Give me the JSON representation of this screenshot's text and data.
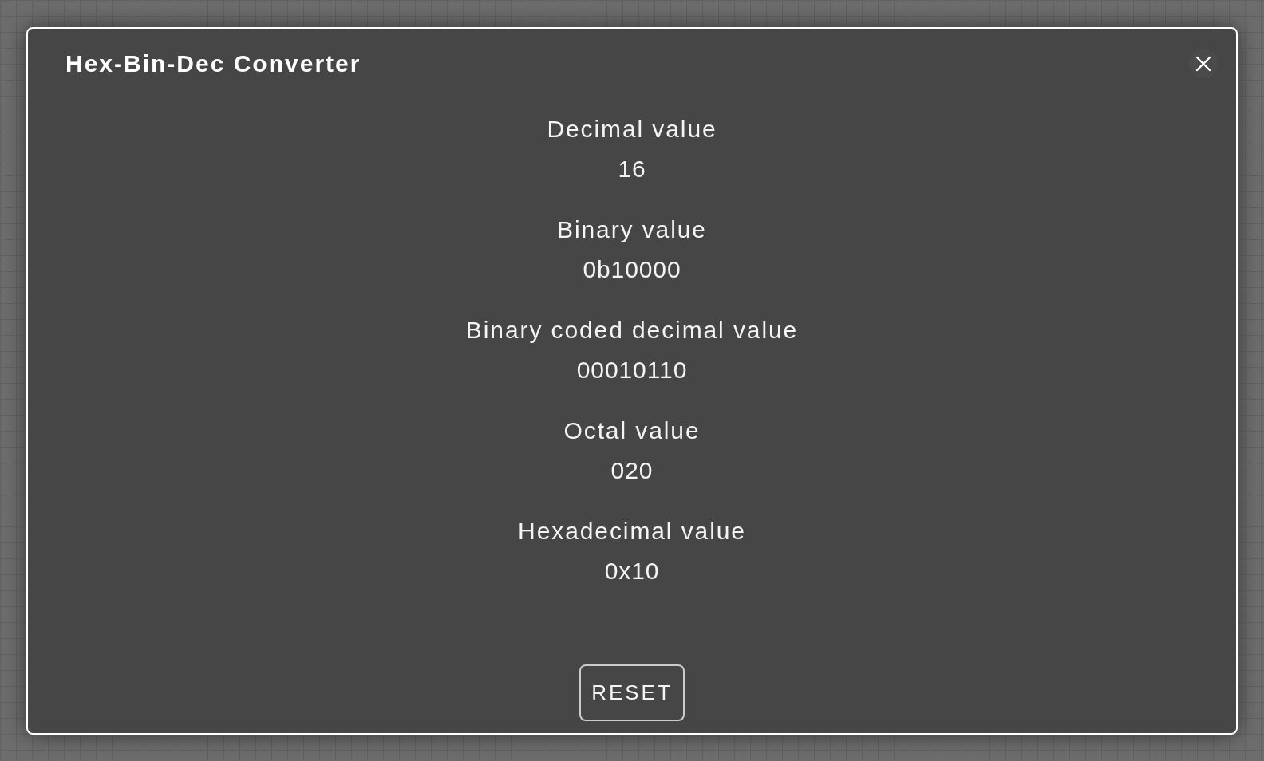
{
  "dialog": {
    "title": "Hex-Bin-Dec Converter",
    "fields": [
      {
        "label": "Decimal value",
        "value": "16"
      },
      {
        "label": "Binary value",
        "value": "0b10000"
      },
      {
        "label": "Binary coded decimal value",
        "value": "00010110"
      },
      {
        "label": "Octal value",
        "value": "020"
      },
      {
        "label": "Hexadecimal value",
        "value": "0x10"
      }
    ],
    "buttons": [
      "RESET"
    ]
  }
}
